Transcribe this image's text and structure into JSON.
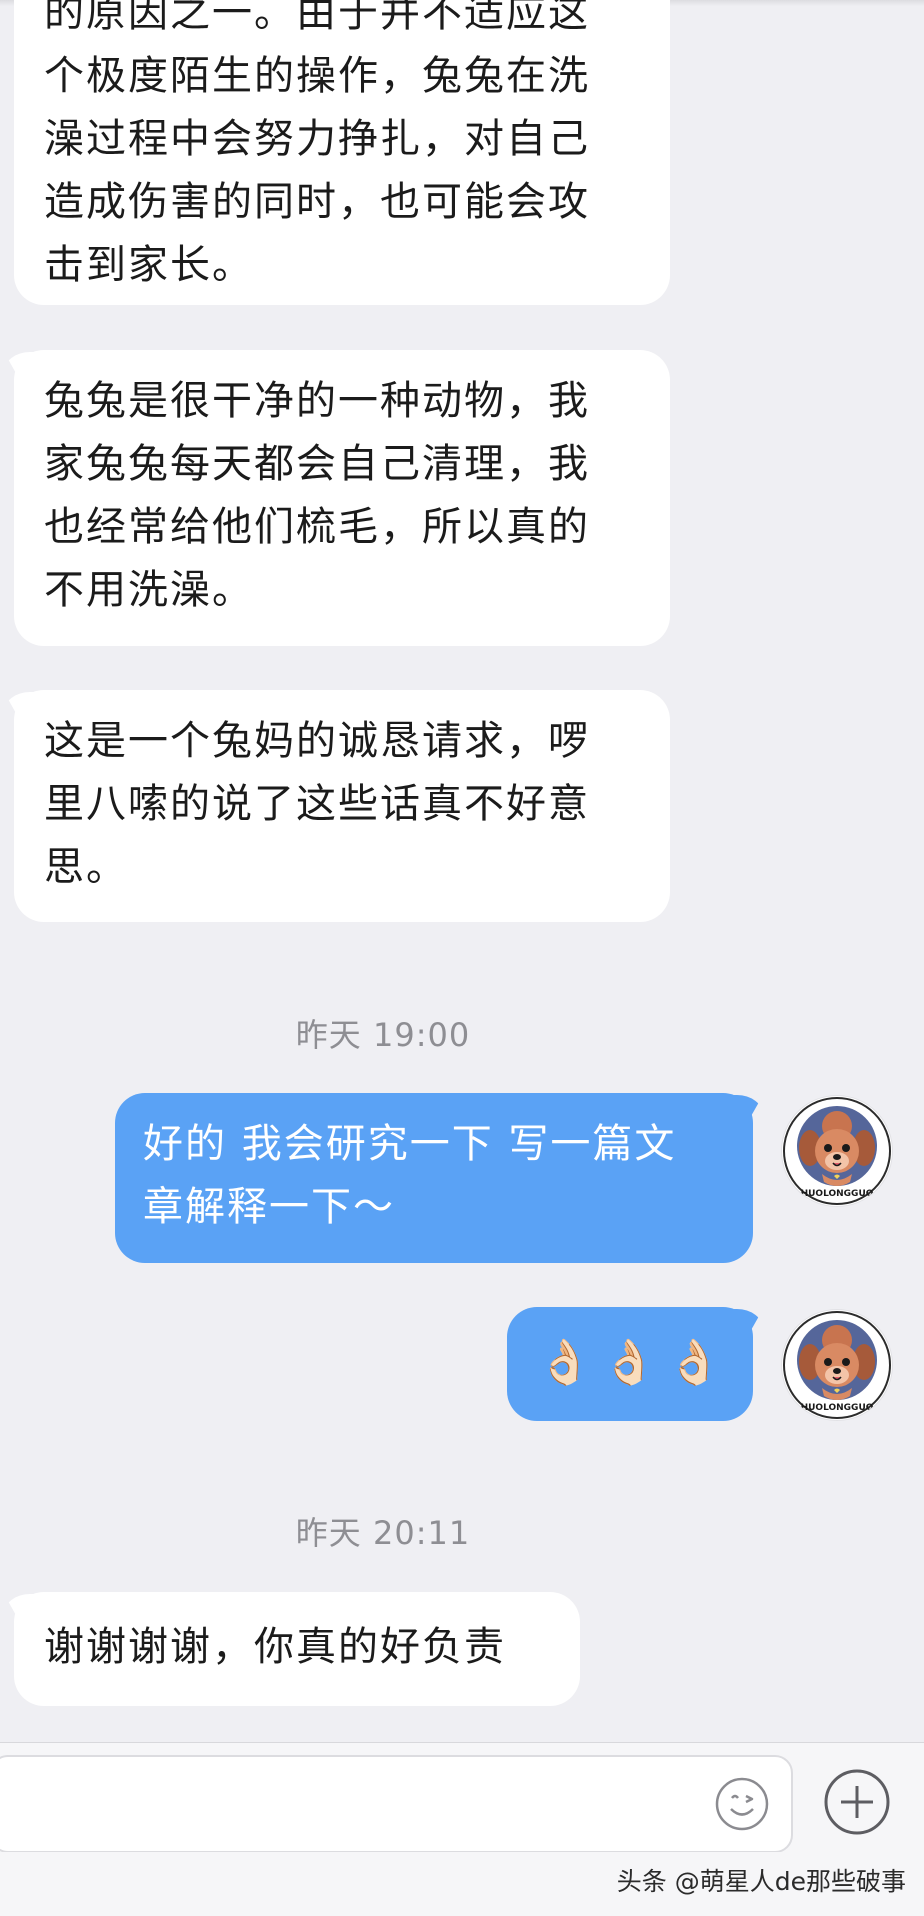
{
  "messages": [
    {
      "lines": [
        "的原因之一。由于并不适应这",
        "个极度陌生的操作，兔兔在洗",
        "澡过程中会努力挣扎，对自己",
        "造成伤害的同时，也可能会攻",
        "击到家长。"
      ]
    },
    {
      "lines": [
        "兔兔是很干净的一种动物，我",
        "家兔兔每天都会自己清理，我",
        "也经常给他们梳毛，所以真的",
        "不用洗澡。"
      ]
    },
    {
      "lines": [
        "这是一个兔妈的诚恳请求，啰",
        "里八嗦的说了这些话真不好意",
        "思。"
      ]
    }
  ],
  "timestamps": [
    "昨天 19:00",
    "昨天 20:11"
  ],
  "outgoing": [
    {
      "lines": [
        "好的 我会研究一下 写一篇文",
        "章解释一下～"
      ]
    },
    {
      "text": "👌🏻👌🏻👌🏻"
    }
  ],
  "last_incoming": {
    "text": "谢谢谢谢，你真的好负责"
  },
  "avatar": {
    "caption": "HUOLONGGUO"
  },
  "input": {
    "placeholder": ""
  },
  "icons": {
    "emoji": "smiley-face-icon",
    "add": "plus-circle-icon"
  },
  "watermark": "头条 @萌星人de那些破事",
  "colors": {
    "outgoing_bubble": "#5aa2f5",
    "incoming_bubble": "#ffffff",
    "background": "#efeff3"
  }
}
